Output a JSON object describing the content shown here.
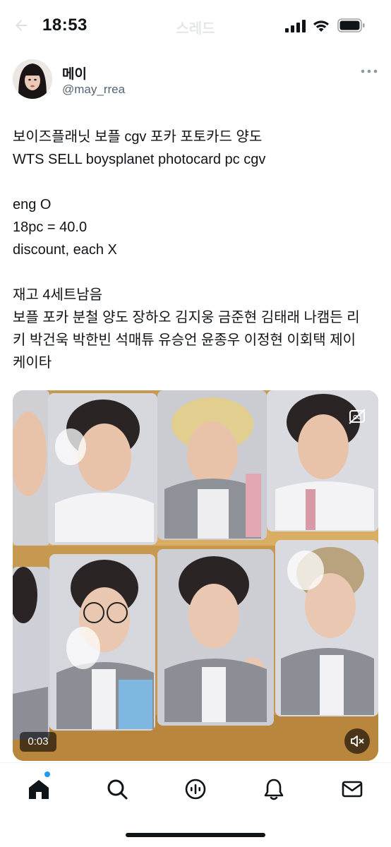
{
  "status_bar": {
    "time": "18:53"
  },
  "header": {
    "title": "스레드"
  },
  "author": {
    "display_name": "메이",
    "handle": "@may_rrea"
  },
  "tweet": {
    "paragraphs": [
      [
        "보이즈플래닛 보플 cgv 포카 포토카드 양도",
        "WTS SELL boysplanet photocard pc cgv"
      ],
      [
        "eng O",
        "18pc = 40.0",
        "discount, each X"
      ],
      [
        "재고 4세트남음",
        "보플 포카 분철 양도 장하오 김지웅 금준현 김태래 나캠든 리",
        "키 박건욱 박한빈 석매튜 유승언 윤종우 이정현 이회택 제이",
        "케이타"
      ]
    ]
  },
  "media": {
    "type": "video",
    "timestamp": "0:03",
    "muted": true
  },
  "bottom_nav": {
    "items": [
      {
        "name": "home",
        "icon": "home-icon",
        "active": true,
        "has_notification_dot": true
      },
      {
        "name": "search",
        "icon": "search-icon",
        "active": false
      },
      {
        "name": "spaces",
        "icon": "spaces-icon",
        "active": false
      },
      {
        "name": "notifications",
        "icon": "bell-icon",
        "active": false
      },
      {
        "name": "messages",
        "icon": "mail-icon",
        "active": false
      }
    ]
  },
  "colors": {
    "text": "#0f1419",
    "secondary": "#536471",
    "accent": "#1d9bf0",
    "media_background": "#c89a52"
  }
}
